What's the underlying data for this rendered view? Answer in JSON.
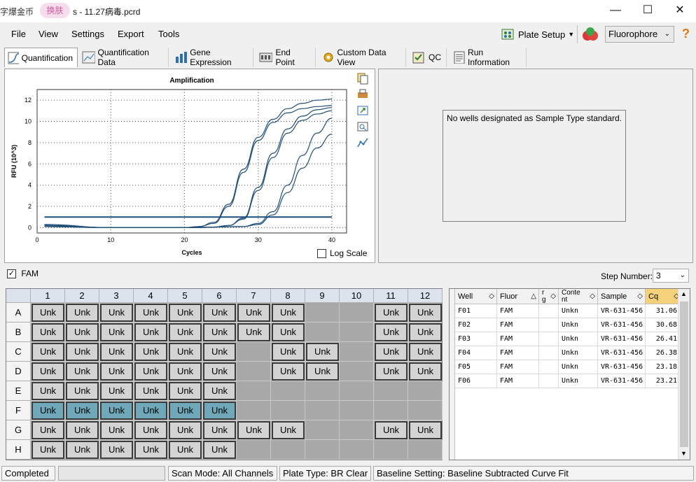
{
  "window": {
    "title_prefix": "字爆金币",
    "ime_pill": "换肤",
    "title": "s - 11.27病毒.pcrd",
    "minimize_glyph": "—",
    "maximize_glyph": "☐",
    "close_glyph": "✕"
  },
  "menu": {
    "file": "File",
    "view": "View",
    "settings": "Settings",
    "export": "Export",
    "tools": "Tools",
    "plate_setup": "Plate Setup",
    "fluorophore": "Fluorophore",
    "help_glyph": "?"
  },
  "tabs": [
    {
      "label": "Quantification",
      "icon": "amplification-chart-icon"
    },
    {
      "label": "Quantification Data",
      "icon": "data-chart-icon"
    },
    {
      "label": "Gene Expression",
      "icon": "bar-chart-icon"
    },
    {
      "label": "End Point",
      "icon": "endpoint-icon"
    },
    {
      "label": "Custom Data View",
      "icon": "gear-icon"
    },
    {
      "label": "QC",
      "icon": "checklist-icon"
    },
    {
      "label": "Run Information",
      "icon": "document-icon"
    }
  ],
  "chart_data": {
    "type": "line",
    "title": "Amplification",
    "xlabel": "Cycles",
    "ylabel": "RFU (10^3)",
    "xlim": [
      0,
      42
    ],
    "ylim": [
      -0.5,
      13
    ],
    "x_ticks": [
      0,
      10,
      20,
      30,
      40
    ],
    "y_ticks": [
      0,
      2,
      4,
      6,
      8,
      10,
      12
    ],
    "grid": true,
    "threshold": 1.0,
    "series": [
      {
        "values": [
          [
            1,
            0.2
          ],
          [
            10,
            0
          ],
          [
            20,
            0
          ],
          [
            22,
            0.1
          ],
          [
            24,
            0.5
          ],
          [
            26,
            2.2
          ],
          [
            28,
            5.5
          ],
          [
            30,
            8.5
          ],
          [
            32,
            10.2
          ],
          [
            34,
            11.2
          ],
          [
            36,
            11.7
          ],
          [
            38,
            12.0
          ],
          [
            40,
            12.1
          ]
        ]
      },
      {
        "values": [
          [
            1,
            0.2
          ],
          [
            10,
            0
          ],
          [
            20,
            0
          ],
          [
            22,
            0.1
          ],
          [
            24,
            0.4
          ],
          [
            26,
            2.0
          ],
          [
            28,
            5.2
          ],
          [
            30,
            8.2
          ],
          [
            32,
            9.9
          ],
          [
            34,
            10.8
          ],
          [
            36,
            11.2
          ],
          [
            38,
            11.4
          ],
          [
            40,
            11.5
          ]
        ]
      },
      {
        "values": [
          [
            1,
            0.1
          ],
          [
            10,
            0
          ],
          [
            20,
            0
          ],
          [
            24,
            0.05
          ],
          [
            26,
            0.2
          ],
          [
            28,
            0.9
          ],
          [
            30,
            3.8
          ],
          [
            32,
            7.0
          ],
          [
            34,
            9.3
          ],
          [
            36,
            10.5
          ],
          [
            38,
            11.1
          ],
          [
            40,
            11.3
          ]
        ]
      },
      {
        "values": [
          [
            1,
            0.1
          ],
          [
            10,
            0
          ],
          [
            20,
            0
          ],
          [
            24,
            0.05
          ],
          [
            26,
            0.2
          ],
          [
            28,
            0.8
          ],
          [
            30,
            3.5
          ],
          [
            32,
            6.6
          ],
          [
            34,
            8.9
          ],
          [
            36,
            10.1
          ],
          [
            38,
            10.7
          ],
          [
            40,
            11.0
          ]
        ]
      },
      {
        "values": [
          [
            1,
            0.2
          ],
          [
            10,
            0
          ],
          [
            20,
            0
          ],
          [
            28,
            0.1
          ],
          [
            30,
            0.4
          ],
          [
            32,
            1.5
          ],
          [
            34,
            4.0
          ],
          [
            36,
            6.8
          ],
          [
            38,
            8.9
          ],
          [
            40,
            10.3
          ]
        ]
      },
      {
        "values": [
          [
            1,
            0.3
          ],
          [
            10,
            0
          ],
          [
            20,
            0
          ],
          [
            28,
            0.1
          ],
          [
            30,
            0.3
          ],
          [
            32,
            1.2
          ],
          [
            34,
            3.3
          ],
          [
            36,
            5.6
          ],
          [
            38,
            7.5
          ],
          [
            40,
            8.8
          ]
        ]
      }
    ]
  },
  "log_scale_label": "Log Scale",
  "std_message": "No wells designated as Sample Type standard.",
  "fam_label": "FAM",
  "step_number_label": "Step Number:",
  "step_number_value": "3",
  "plate": {
    "columns": [
      "1",
      "2",
      "3",
      "4",
      "5",
      "6",
      "7",
      "8",
      "9",
      "10",
      "11",
      "12"
    ],
    "rows": [
      "A",
      "B",
      "C",
      "D",
      "E",
      "F",
      "G",
      "H"
    ],
    "well_label": "Unk",
    "layout": [
      "XXXXXXXX..XX",
      "XXXXXXXX..XX",
      "XXXXXX.XX.XX",
      "XXXXXX.XX.XX",
      "XXXXXX......",
      "SSSSSS......",
      "XXXXXXXX..XX",
      "XXXXXX......"
    ]
  },
  "table": {
    "headers": [
      "Well",
      "Fluor",
      "r\ng",
      "Conte\nnt",
      "Sample",
      "Cq"
    ],
    "rows": [
      [
        "F01",
        "FAM",
        "",
        "Unkn",
        "VR-631-456",
        "31.06"
      ],
      [
        "F02",
        "FAM",
        "",
        "Unkn",
        "VR-631-456",
        "30.68"
      ],
      [
        "F03",
        "FAM",
        "",
        "Unkn",
        "VR-631-456",
        "26.41"
      ],
      [
        "F04",
        "FAM",
        "",
        "Unkn",
        "VR-631-456",
        "26.38"
      ],
      [
        "F05",
        "FAM",
        "",
        "Unkn",
        "VR-631-456",
        "23.18"
      ],
      [
        "F06",
        "FAM",
        "",
        "Unkn",
        "VR-631-456",
        "23.21"
      ]
    ]
  },
  "status": {
    "completed": "Completed",
    "scan_mode": "Scan Mode: All Channels",
    "plate_type": "Plate Type: BR Clear",
    "baseline": "Baseline Setting: Baseline Subtracted Curve Fit"
  },
  "colors": {
    "curve": "#1f4e79",
    "selected_well": "#6fa8b8",
    "accent_cq_header": "#f5d27a"
  }
}
